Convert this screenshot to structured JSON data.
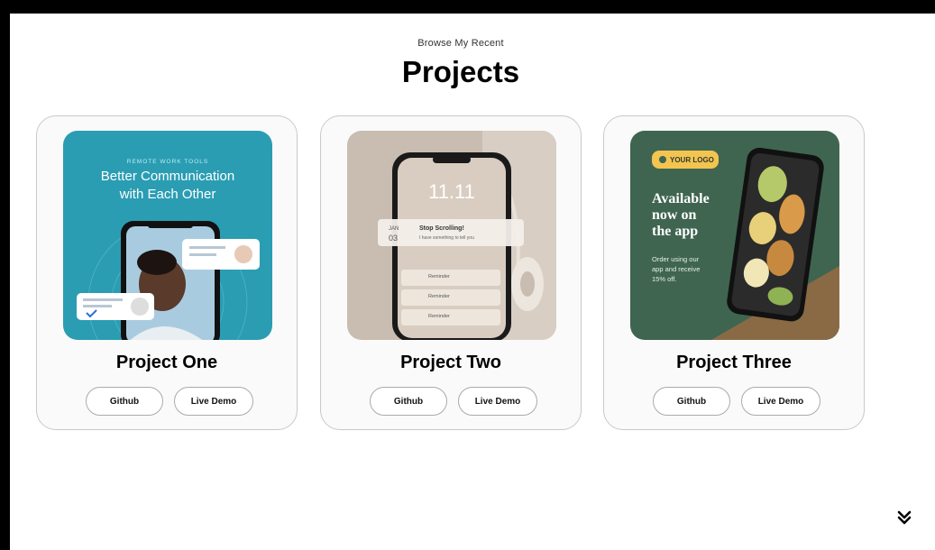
{
  "header": {
    "eyebrow": "Browse My Recent",
    "title": "Projects"
  },
  "projects": [
    {
      "name": "Project One",
      "github_label": "Github",
      "demo_label": "Live Demo",
      "image_text": {
        "kicker": "REMOTE WORK TOOLS",
        "line1": "Better Communication",
        "line2": "with Each Other"
      }
    },
    {
      "name": "Project Two",
      "github_label": "Github",
      "demo_label": "Live Demo",
      "image_text": {
        "time": "11.11",
        "month": "JAN",
        "day": "03",
        "notif_title": "Stop Scrolling!",
        "notif_body": "I have something to tell you",
        "r1": "Reminder",
        "r2": "Reminder",
        "r3": "Reminder"
      }
    },
    {
      "name": "Project Three",
      "github_label": "Github",
      "demo_label": "Live Demo",
      "image_text": {
        "logo": "YOUR LOGO",
        "h1": "Available",
        "h2": "now on",
        "h3": "the app",
        "b1": "Order using our",
        "b2": "app and receive",
        "b3": "15% off."
      }
    }
  ],
  "icons": {
    "scroll": "double-chevron-down-icon",
    "logo_mark": "chef-hat-icon"
  },
  "colors": {
    "teal": "#2a9db3",
    "green": "#3f6550",
    "beige": "#c9bcb0",
    "logo_yellow": "#f3c450"
  }
}
